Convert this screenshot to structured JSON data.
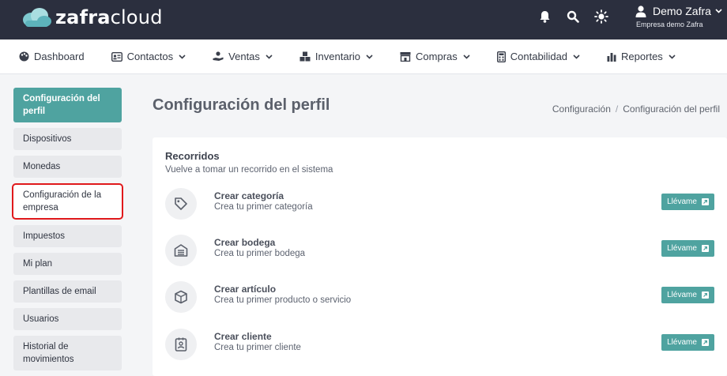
{
  "header": {
    "logo_bold": "zafra",
    "logo_light": "cloud",
    "user_name": "Demo Zafra",
    "company": "Empresa demo Zafra",
    "icons": [
      "bell-icon",
      "search-icon",
      "sun-icon",
      "user-icon"
    ]
  },
  "nav": {
    "items": [
      {
        "label": "Dashboard",
        "icon": "palette-icon",
        "dropdown": false
      },
      {
        "label": "Contactos",
        "icon": "id-card-icon",
        "dropdown": true
      },
      {
        "label": "Ventas",
        "icon": "hand-money-icon",
        "dropdown": true
      },
      {
        "label": "Inventario",
        "icon": "boxes-icon",
        "dropdown": true
      },
      {
        "label": "Compras",
        "icon": "store-icon",
        "dropdown": true
      },
      {
        "label": "Contabilidad",
        "icon": "calculator-icon",
        "dropdown": true
      },
      {
        "label": "Reportes",
        "icon": "bar-chart-icon",
        "dropdown": true
      }
    ]
  },
  "sidebar": {
    "items": [
      {
        "label": "Configuración del perfil",
        "state": "active"
      },
      {
        "label": "Dispositivos"
      },
      {
        "label": "Monedas"
      },
      {
        "label": "Configuración de la empresa",
        "state": "highlighted"
      },
      {
        "label": "Impuestos"
      },
      {
        "label": "Mi plan"
      },
      {
        "label": "Plantillas de email"
      },
      {
        "label": "Usuarios"
      },
      {
        "label": "Historial de movimientos"
      }
    ]
  },
  "main": {
    "title": "Configuración del perfil",
    "breadcrumb": [
      "Configuración",
      "Configuración del perfil"
    ]
  },
  "tours": {
    "title": "Recorridos",
    "subtitle": "Vuelve a tomar un recorrido en el sistema",
    "items": [
      {
        "title": "Crear categoría",
        "desc": "Crea tu primer categoría",
        "button": "Llévame",
        "icon": "tag-icon"
      },
      {
        "title": "Crear bodega",
        "desc": "Crea tu primer bodega",
        "button": "Llévame",
        "icon": "warehouse-icon"
      },
      {
        "title": "Crear artículo",
        "desc": "Crea tu primer producto o servicio",
        "button": "Llévame",
        "icon": "box-icon"
      },
      {
        "title": "Crear cliente",
        "desc": "Crea tu primer cliente",
        "button": "Llévame",
        "icon": "contact-badge-icon"
      }
    ]
  },
  "colors": {
    "topbar": "#2b2f3e",
    "accent": "#4fa3a0",
    "highlight_border": "#e0191c"
  }
}
